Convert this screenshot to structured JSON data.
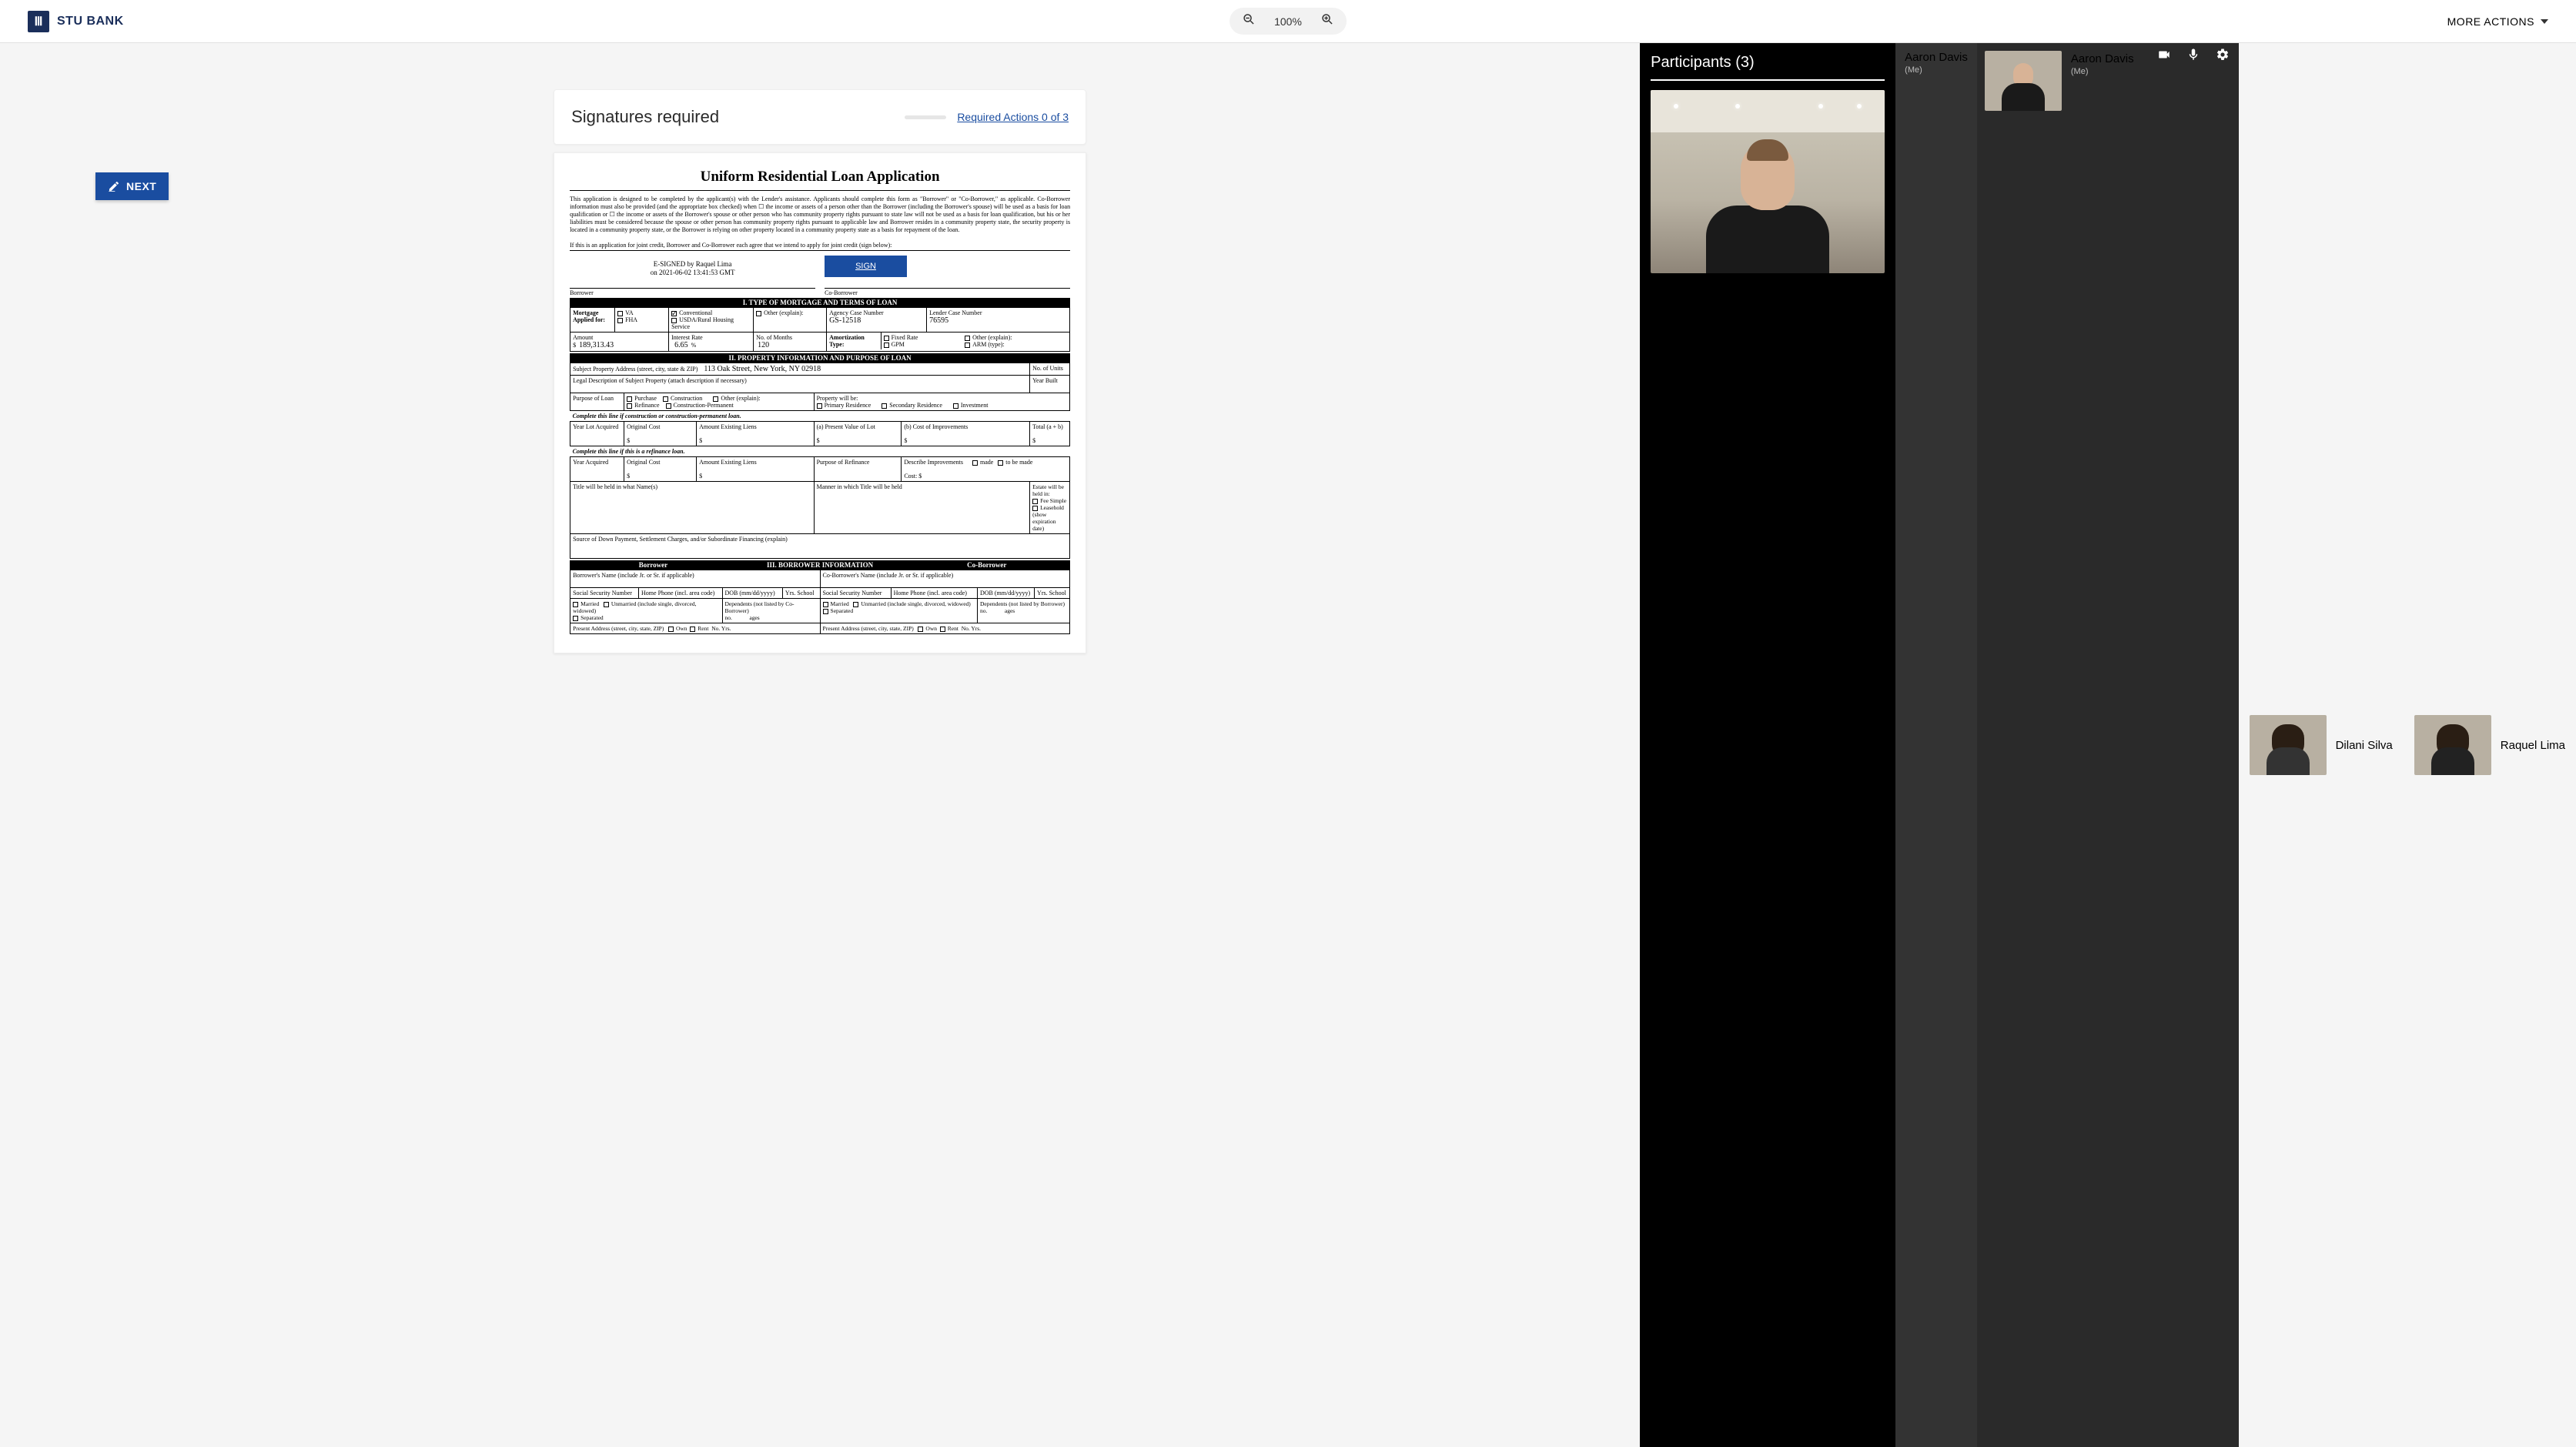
{
  "header": {
    "brand": "STU BANK",
    "zoom": "100%",
    "more": "MORE ACTIONS"
  },
  "next_button": "NEXT",
  "sig_card": {
    "title": "Signatures required",
    "link": "Required Actions 0 of 3"
  },
  "doc": {
    "title": "Uniform Residential Loan Application",
    "intro": "This application is designed to be completed by the applicant(s) with the Lender's assistance. Applicants should complete this form as \"Borrower\" or \"Co-Borrower,\" as applicable. Co-Borrower information must also be provided (and the appropriate box checked) when ☐ the income or assets of a person other than the Borrower (including the Borrower's spouse) will be used as a basis for loan qualification or ☐ the income or assets of the Borrower's spouse or other person who has community property rights pursuant to state law will not be used as a basis for loan qualification, but his or her liabilities must be considered because the spouse or other person has community property rights pursuant to applicable law and Borrower resides in a community property state, the security property is located in a community property state, or the Borrower is relying on other property located in a community property state as a basis for repayment of the loan.",
    "joint": "If this is an application for joint credit, Borrower and Co-Borrower each agree that we intend to apply for joint credit (sign below):",
    "esigned_line1": "E-SIGNED by Raquel Lima",
    "esigned_line2": "on 2021-06-02 13:41:53 GMT",
    "borrower_label": "Borrower",
    "coborrower_label": "Co-Borrower",
    "sign_btn": "SIGN",
    "sec1": "I. TYPE OF MORTGAGE AND TERMS OF LOAN",
    "mortgage_applied": "Mortgage Applied for:",
    "opts": {
      "va": "VA",
      "fha": "FHA",
      "conv": "Conventional",
      "usda": "USDA/Rural Housing Service",
      "other": "Other (explain):"
    },
    "agency_label": "Agency Case Number",
    "agency_val": "GS-12518",
    "lender_label": "Lender Case Number",
    "lender_val": "76595",
    "amount_label": "Amount",
    "amount_val": "189,313.43",
    "rate_label": "Interest Rate",
    "rate_val": "6.65",
    "months_label": "No. of Months",
    "months_val": "120",
    "amort_label": "Amortization Type:",
    "amort": {
      "fixed": "Fixed Rate",
      "gpm": "GPM",
      "other": "Other (explain):",
      "arm": "ARM (type):"
    },
    "sec2": "II. PROPERTY INFORMATION AND PURPOSE OF LOAN",
    "addr_label": "Subject Property Address (street, city, state & ZIP)",
    "addr_val": "113 Oak Street, New York, NY 02918",
    "units_label": "No. of Units",
    "legal_label": "Legal Description of Subject Property (attach description if necessary)",
    "year_built_label": "Year Built",
    "purpose_label": "Purpose of Loan",
    "purpose": {
      "purchase": "Purchase",
      "refi": "Refinance",
      "constr": "Construction",
      "constrperm": "Construction-Permanent",
      "other": "Other (explain):"
    },
    "propwill_label": "Property will be:",
    "propwill": {
      "primary": "Primary Residence",
      "secondary": "Secondary Residence",
      "invest": "Investment"
    },
    "constr_line": "Complete this line if construction or construction-permanent loan.",
    "refi_line": "Complete this line if this is a refinance loan.",
    "year_lot": "Year Lot Acquired",
    "orig_cost": "Original Cost",
    "amt_liens": "Amount Existing Liens",
    "pres_val": "(a) Present Value of Lot",
    "cost_impr": "(b) Cost of Improvements",
    "total_ab": "Total (a + b)",
    "year_acq": "Year Acquired",
    "purp_refi": "Purpose of Refinance",
    "desc_impr": "Describe Improvements",
    "made": "made",
    "tobemade": "to be made",
    "cost": "Cost: $",
    "title_names": "Title will be held in what Name(s)",
    "manner": "Manner in which Title will be held",
    "estate_label": "Estate will be held in:",
    "fee": "Fee Simple",
    "lease": "Leasehold (show expiration date)",
    "down_label": "Source of Down Payment, Settlement Charges, and/or Subordinate Financing (explain)",
    "sec3": "III. BORROWER INFORMATION",
    "b_name": "Borrower's Name (include Jr. or Sr. if applicable)",
    "cb_name": "Co-Borrower's Name (include Jr. or Sr. if applicable)",
    "ssn": "Social Security Number",
    "phone": "Home Phone (incl. area code)",
    "dob": "DOB (mm/dd/yyyy)",
    "yrs": "Yrs. School",
    "married": "Married",
    "unmarried": "Unmarried (include single, divorced, widowed)",
    "separated": "Separated",
    "deps": "Dependents (not listed by Co-Borrower)",
    "deps2": "Dependents (not listed by Borrower)",
    "no": "no.",
    "ages": "ages",
    "pres_addr": "Present Address (street, city, state, ZIP)",
    "own": "Own",
    "rent": "Rent",
    "noyrs": "No. Yrs."
  },
  "panel": {
    "title": "Participants (3)",
    "me": "(Me)",
    "p1": "Aaron Davis",
    "p2": "Aaron Davis",
    "p3": "Dilani Silva",
    "p4": "Raquel Lima"
  }
}
